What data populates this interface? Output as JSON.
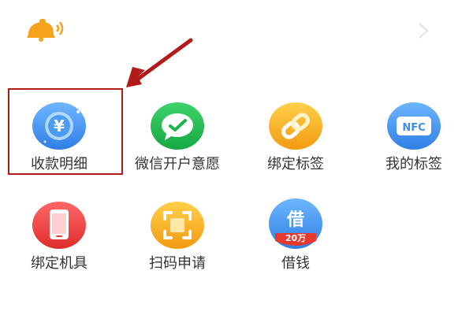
{
  "grid": {
    "items": [
      {
        "label": "收款明细",
        "icon": "yuan-coin-icon"
      },
      {
        "label": "微信开户意愿",
        "icon": "wechat-pay-icon"
      },
      {
        "label": "绑定标签",
        "icon": "chain-link-icon"
      },
      {
        "label": "我的标签",
        "icon": "nfc-icon",
        "icon_text": "NFC"
      },
      {
        "label": "绑定机具",
        "icon": "phone-icon"
      },
      {
        "label": "扫码申请",
        "icon": "scan-icon"
      },
      {
        "label": "借钱",
        "icon": "loan-icon",
        "icon_text": "借",
        "badge": "20万"
      }
    ]
  },
  "annotation": {
    "highlight_color": "#b31b1b"
  },
  "colors": {
    "blue": "#3a8ee8",
    "green": "#1fb24b",
    "orange": "#f6a21b",
    "red": "#e83b3b",
    "label": "#333333"
  }
}
